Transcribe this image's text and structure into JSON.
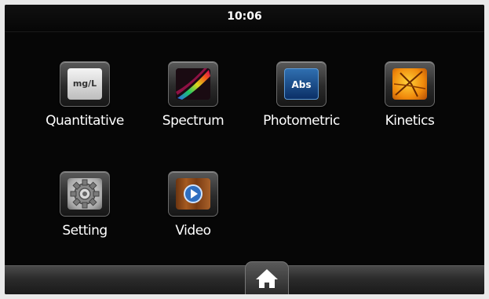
{
  "status": {
    "time": "10:06"
  },
  "apps": [
    {
      "label": "Quantitative",
      "icon": "mg-per-liter-icon",
      "icon_text": "mg/L"
    },
    {
      "label": "Spectrum",
      "icon": "spectrum-icon"
    },
    {
      "label": "Photometric",
      "icon": "absorbance-icon",
      "icon_text": "Abs"
    },
    {
      "label": "Kinetics",
      "icon": "kinetics-icon"
    },
    {
      "label": "Setting",
      "icon": "gear-icon"
    },
    {
      "label": "Video",
      "icon": "play-icon"
    }
  ],
  "nav": {
    "home_icon": "home-icon"
  },
  "colors": {
    "screen_bg": "#060606",
    "text": "#ffffff",
    "abs_blue": "#1f5aa0",
    "kinetics_orange": "#f08a0c"
  }
}
